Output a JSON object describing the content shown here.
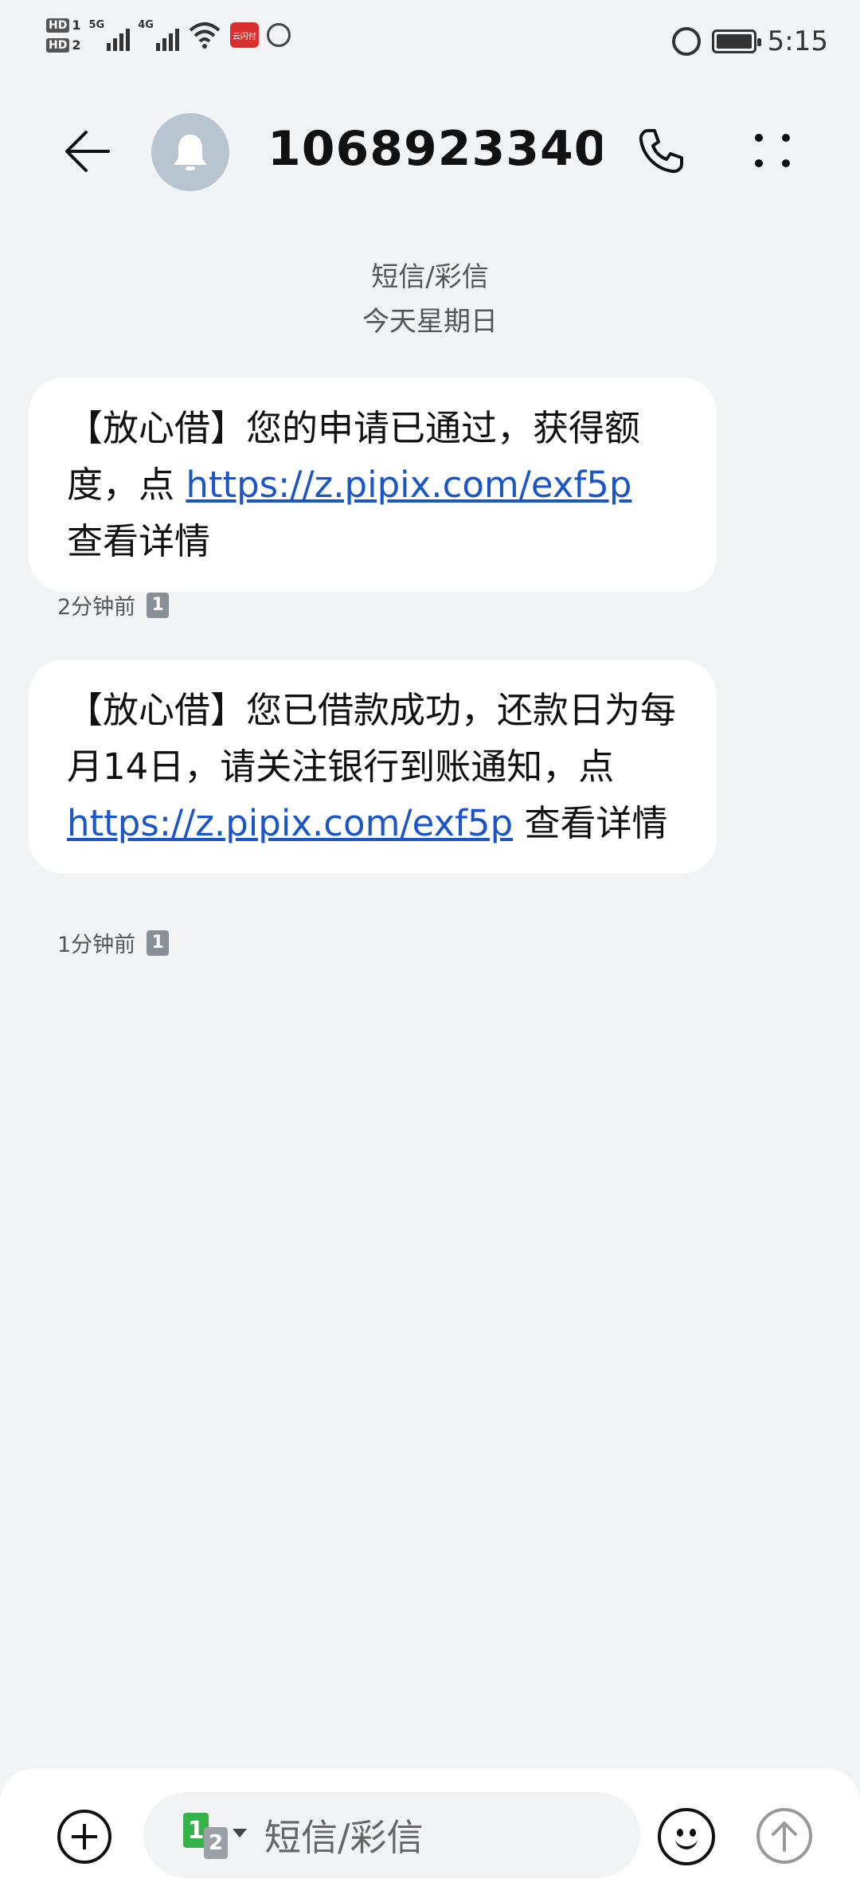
{
  "status_bar": {
    "hd1": "HD",
    "sim1": "1",
    "hd2": "HD",
    "sim2": "2",
    "net1": "5G",
    "net2": "4G",
    "app_badge_label": "云闪付",
    "time": "5:15"
  },
  "header": {
    "title": "1068923340…",
    "avatar_icon": "bell-icon",
    "back_icon": "arrow-left-icon",
    "call_icon": "phone-icon",
    "more_icon": "more-vertical-icon"
  },
  "thread": {
    "channel_label": "短信/彩信",
    "date_label": "今天星期日"
  },
  "messages": [
    {
      "text_before": "【放心借】您的申请已通过，获得额度，点 ",
      "link": "https://z.pipix.com/exf5p",
      "text_after": " 查看详情",
      "time": "2分钟前",
      "sim": "1"
    },
    {
      "text_before": "【放心借】您已借款成功，还款日为每月14日，请关注银行到账通知，点 ",
      "link": "https://z.pipix.com/exf5p",
      "text_after": " 查看详情",
      "time": "1分钟前",
      "sim": "1"
    }
  ],
  "composer": {
    "placeholder": "短信/彩信",
    "sim_primary": "1",
    "sim_secondary": "2",
    "add_icon": "plus-circle-icon",
    "emoji_icon": "smiley-icon",
    "send_icon": "arrow-up-circle-icon"
  },
  "colors": {
    "background": "#f1f3f5",
    "bubble": "#ffffff",
    "link": "#1a55c9",
    "sim_green": "#36b24a"
  }
}
